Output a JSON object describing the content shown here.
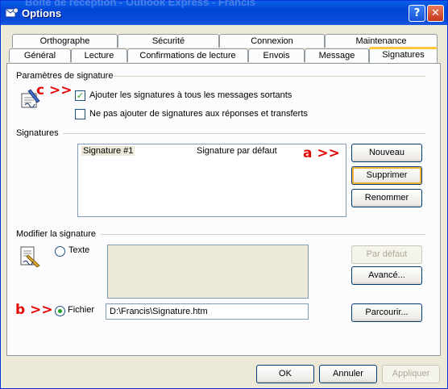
{
  "window": {
    "title": "Options",
    "background_title": "Boîte de réception - Outlook Express - Francis",
    "help_label": "?",
    "close_label": "✕"
  },
  "tabs_row1": [
    "Orthographe",
    "Sécurité",
    "Connexion",
    "Maintenance"
  ],
  "tabs_row2": [
    "Général",
    "Lecture",
    "Confirmations de lecture",
    "Envois",
    "Message",
    "Signatures"
  ],
  "active_tab": "Signatures",
  "settings": {
    "group_label": "Paramètres de signature",
    "add_all_label": "Ajouter les signatures à tous les messages sortants",
    "add_all_checked": true,
    "no_replies_label": "Ne pas ajouter de signatures aux réponses et transferts",
    "no_replies_checked": false
  },
  "signatures": {
    "group_label": "Signatures",
    "rows": [
      {
        "name": "Signature #1",
        "status": "Signature par défaut"
      }
    ],
    "new_label": "Nouveau",
    "delete_label": "Supprimer",
    "rename_label": "Renommer"
  },
  "edit": {
    "group_label": "Modifier la signature",
    "text_label": "Texte",
    "file_label": "Fichier",
    "file_path": "D:\\Francis\\Signature.htm",
    "default_label": "Par défaut",
    "advanced_label": "Avancé...",
    "browse_label": "Parcourir...",
    "selected_option": "Fichier"
  },
  "footer": {
    "ok_label": "OK",
    "cancel_label": "Annuler",
    "apply_label": "Appliquer"
  },
  "annotations": {
    "a": "a >>",
    "b": "b >>",
    "c": "c >>",
    "color": "#e30808"
  },
  "colors": {
    "titlebar": "#0046d5",
    "dialog": "#ece9d8",
    "tab_highlight": "#ffc83c"
  }
}
